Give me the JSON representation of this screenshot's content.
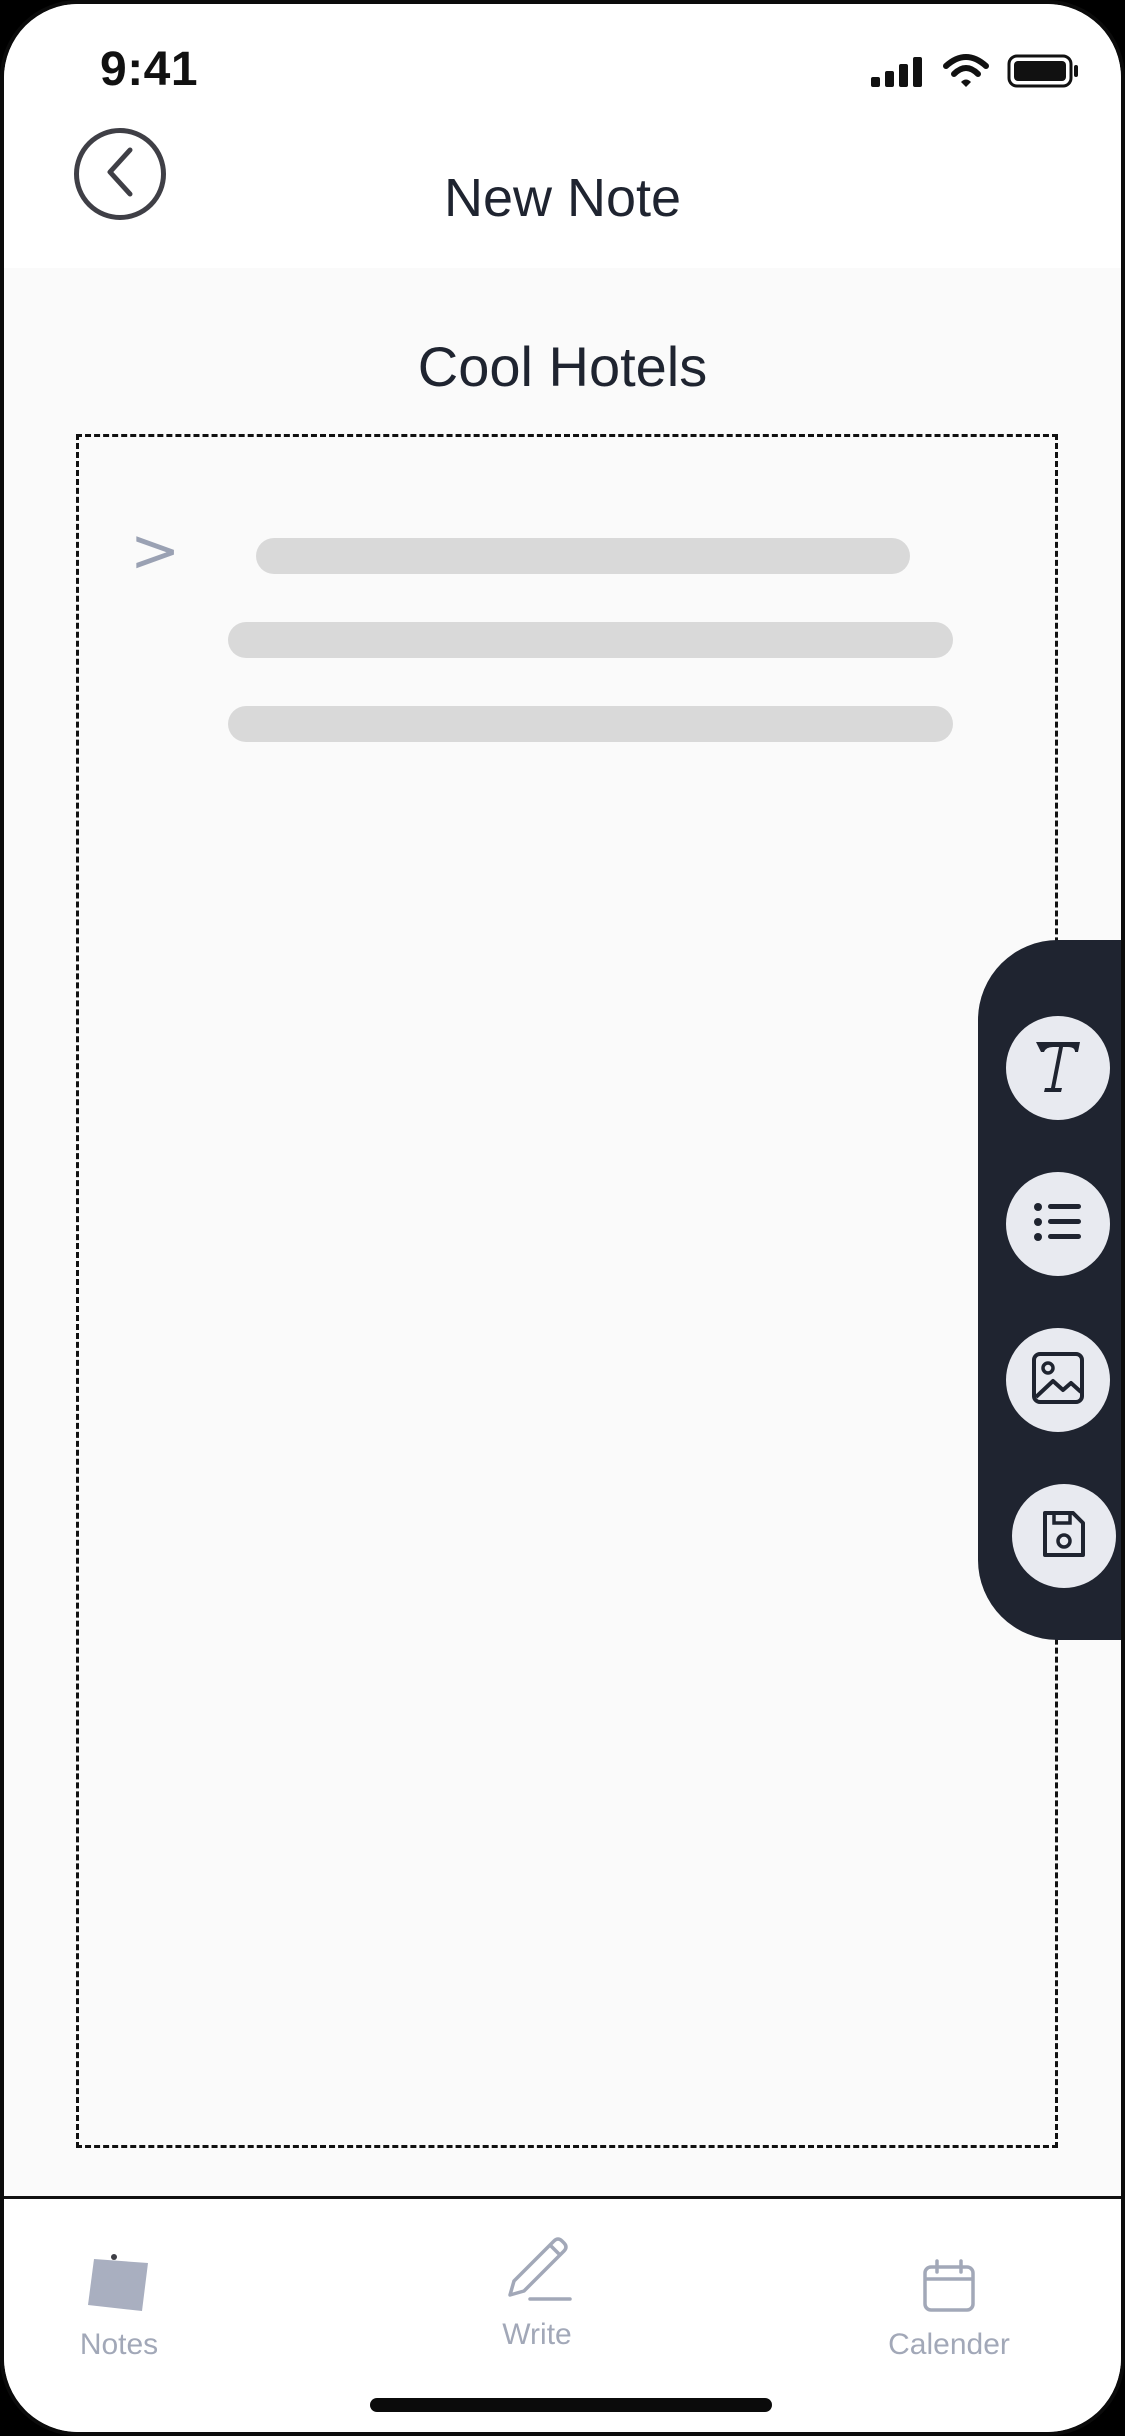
{
  "status_bar": {
    "time": "9:41",
    "icons": [
      "signal-icon",
      "wifi-icon",
      "battery-icon"
    ]
  },
  "header": {
    "title": "New Note",
    "back_icon": "chevron-left-icon"
  },
  "note": {
    "title": "Cool Hotels",
    "prompt_symbol": ">"
  },
  "toolbar": {
    "tools": [
      "text-format-icon",
      "list-icon",
      "image-icon",
      "save-icon"
    ]
  },
  "bottom_nav": {
    "items": [
      {
        "label": "Notes",
        "icon": "notes-icon"
      },
      {
        "label": "Write",
        "icon": "pencil-icon"
      },
      {
        "label": "Calender",
        "icon": "calendar-icon"
      }
    ]
  },
  "colors": {
    "toolbar_bg": "#1f2430",
    "tool_bg": "#e8eaf0",
    "placeholder_line": "#d9d9d9",
    "muted_icon": "#a2a8b8"
  }
}
